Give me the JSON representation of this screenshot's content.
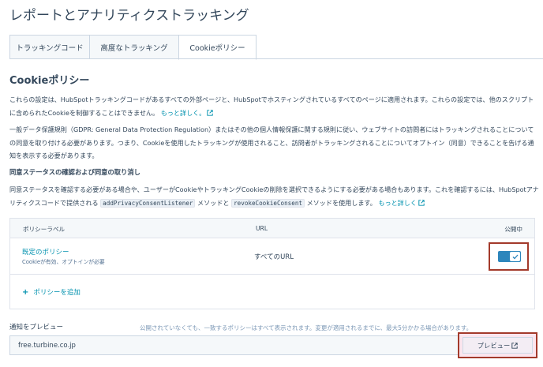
{
  "page": {
    "title": "レポートとアナリティクストラッキング"
  },
  "tabs": [
    {
      "label": "トラッキングコード"
    },
    {
      "label": "高度なトラッキング"
    },
    {
      "label": "Cookieポリシー"
    }
  ],
  "section": {
    "title": "Cookieポリシー",
    "intro_text": "これらの設定は、HubSpotトラッキングコードがあるすべての外部ページと、HubSpotでホスティングされているすべてのページに適用されます。これらの設定では、他のスクリプトに含められたCookieを制御することはできません。",
    "intro_link": "もっと詳しく。",
    "gdpr_text": "一般データ保護規則（GDPR: General Data Protection Regulation）またはその他の個人情報保護に関する規則に従い、ウェブサイトの訪問者にはトラッキングされることについての同意を取り付ける必要があります。つまり、Cookieを使用したトラッキングが使用されること、訪問者がトラッキングされることについてオプトイン（同意）できることを告げる通知を表示する必要があります。",
    "consent_title": "同意ステータスの確認および同意の取り消し",
    "consent_text_1": "同意ステータスを確認する必要がある場合や、ユーザーがCookieやトラッキングCookieの削除を選択できるようにする必要がある場合もあります。これを確認するには、HubSpotアナリティクスコードで提供される",
    "consent_code_1": "addPrivacyConsentListener",
    "consent_text_2": "メソッドと",
    "consent_code_2": "revokeCookieConsent",
    "consent_text_3": "メソッドを使用します。",
    "consent_link": "もっと詳しく"
  },
  "table": {
    "headers": {
      "label": "ポリシーラベル",
      "url": "URL",
      "published": "公開中"
    },
    "rows": [
      {
        "name": "既定のポリシー",
        "description": "Cookieが有効、オプトインが必要",
        "url": "すべてのURL",
        "published": true
      }
    ],
    "add_label": "ポリシーを追加"
  },
  "preview": {
    "label": "通知をプレビュー",
    "note": "公開されていなくても、一致するポリシーはすべて表示されます。変更が適用されるまでに、最大5分かかる場合があります。",
    "url_value": "free.turbine.co.jp",
    "button_label": "プレビュー"
  },
  "colors": {
    "link": "#0091ae",
    "toggle_on": "#2d86bc",
    "highlight_border": "#a33a2b",
    "text": "#33475b"
  },
  "icons": [
    "external-link-icon",
    "check-icon",
    "plus-icon"
  ]
}
